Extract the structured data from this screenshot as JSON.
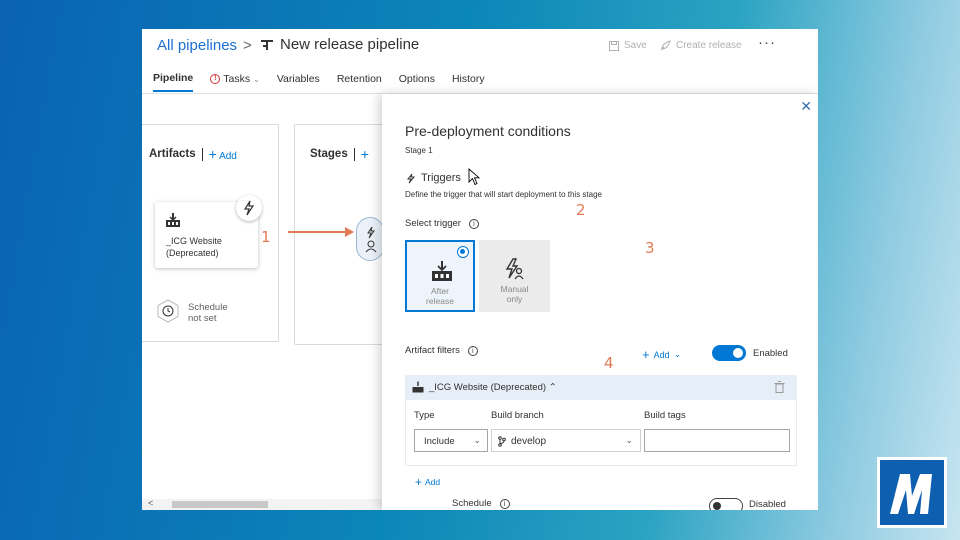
{
  "header": {
    "breadcrumb_root": "All pipelines",
    "breadcrumb_sep": ">",
    "pipeline_title": "New release pipeline",
    "save_label": "Save",
    "create_release_label": "Create release",
    "more_label": "···"
  },
  "tabs": [
    {
      "label": "Pipeline",
      "active": true
    },
    {
      "label": "Tasks"
    },
    {
      "label": "Variables"
    },
    {
      "label": "Retention"
    },
    {
      "label": "Options"
    },
    {
      "label": "History"
    }
  ],
  "canvas": {
    "artifacts_title": "Artifacts",
    "artifacts_add": "Add",
    "artifact_name_line1": "_ICG Website",
    "artifact_name_line2": "(Deprecated)",
    "schedule_line1": "Schedule",
    "schedule_line2": "not set",
    "stages_title": "Stages"
  },
  "annotations": [
    "1",
    "2",
    "3",
    "4"
  ],
  "panel": {
    "title": "Pre-deployment conditions",
    "subtitle": "Stage 1",
    "triggers_heading": "Triggers",
    "triggers_desc": "Define the trigger that will start deployment to this stage",
    "select_trigger_label": "Select trigger",
    "option_after_line1": "After",
    "option_after_line2": "release",
    "option_manual_line1": "Manual",
    "option_manual_line2": "only",
    "artifact_filters_label": "Artifact filters",
    "add_label": "Add",
    "enabled_label": "Enabled",
    "filter_artifact_name": "_ICG Website (Deprecated)",
    "col_type": "Type",
    "col_branch": "Build branch",
    "col_tags": "Build tags",
    "type_value": "Include",
    "branch_value": "develop",
    "add_filter_label": "Add",
    "schedule_label": "Schedule",
    "disabled_label": "Disabled"
  },
  "colors": {
    "accent": "#0078d4",
    "annotation": "#e07a55",
    "link": "#1d6fd1"
  }
}
